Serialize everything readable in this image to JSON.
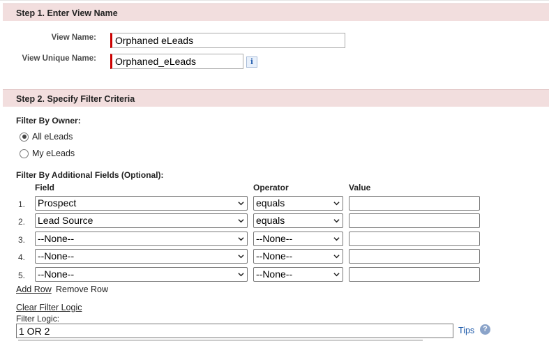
{
  "step1": {
    "title": "Step 1. Enter View Name",
    "view_name_label": "View Name:",
    "view_name_value": "Orphaned eLeads",
    "unique_name_label": "View Unique Name:",
    "unique_name_value": "Orphaned_eLeads",
    "info_icon_glyph": "i"
  },
  "step2": {
    "title": "Step 2. Specify Filter Criteria",
    "filter_owner_label": "Filter By Owner:",
    "owner_options": [
      {
        "label": "All eLeads",
        "checked": true
      },
      {
        "label": "My eLeads",
        "checked": false
      }
    ],
    "additional_label": "Filter By Additional Fields (Optional):",
    "columns": {
      "field": "Field",
      "operator": "Operator",
      "value": "Value"
    },
    "rows": [
      {
        "num": "1.",
        "field": "Prospect",
        "operator": "equals",
        "value": ""
      },
      {
        "num": "2.",
        "field": "Lead Source",
        "operator": "equals",
        "value": ""
      },
      {
        "num": "3.",
        "field": "--None--",
        "operator": "--None--",
        "value": ""
      },
      {
        "num": "4.",
        "field": "--None--",
        "operator": "--None--",
        "value": ""
      },
      {
        "num": "5.",
        "field": "--None--",
        "operator": "--None--",
        "value": ""
      }
    ],
    "add_row": "Add Row",
    "remove_row": "Remove Row",
    "clear_logic": "Clear Filter Logic",
    "logic_label": "Filter Logic:",
    "logic_value": "1 OR 2",
    "tips": "Tips",
    "help_glyph": "?"
  },
  "colors": {
    "header_bg": "#f2dede",
    "required_marker": "#cc0000",
    "link_blue": "#1a57a8"
  }
}
